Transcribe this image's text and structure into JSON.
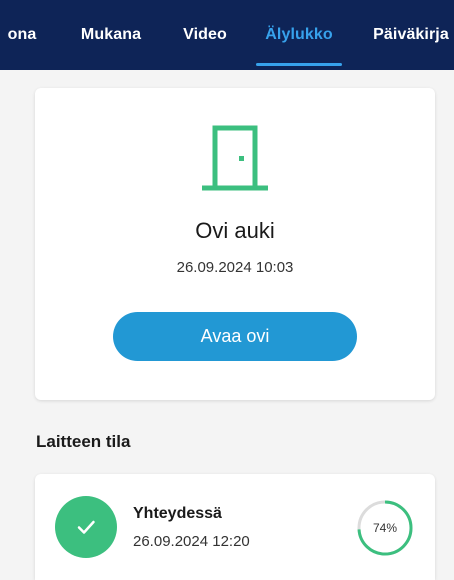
{
  "tabs": [
    {
      "label": "ona",
      "active": false
    },
    {
      "label": "Mukana",
      "active": false
    },
    {
      "label": "Video",
      "active": false
    },
    {
      "label": "Älylukko",
      "active": true
    },
    {
      "label": "Päiväkirja",
      "active": false
    }
  ],
  "door": {
    "icon": "door-icon",
    "status": "Ovi auki",
    "timestamp": "26.09.2024 10:03",
    "open_button_label": "Avaa ovi"
  },
  "device_section": {
    "title": "Laitteen tila"
  },
  "device_status": {
    "icon": "check-icon",
    "label": "Yhteydessä",
    "timestamp": "26.09.2024 12:20",
    "battery_label": "74%",
    "battery_fraction": 0.74
  },
  "colors": {
    "topbar": "#0e2457",
    "accent": "#37a2ec",
    "button": "#2298d4",
    "door_icon": "#3cbf7f",
    "success": "#3cbf7f"
  }
}
